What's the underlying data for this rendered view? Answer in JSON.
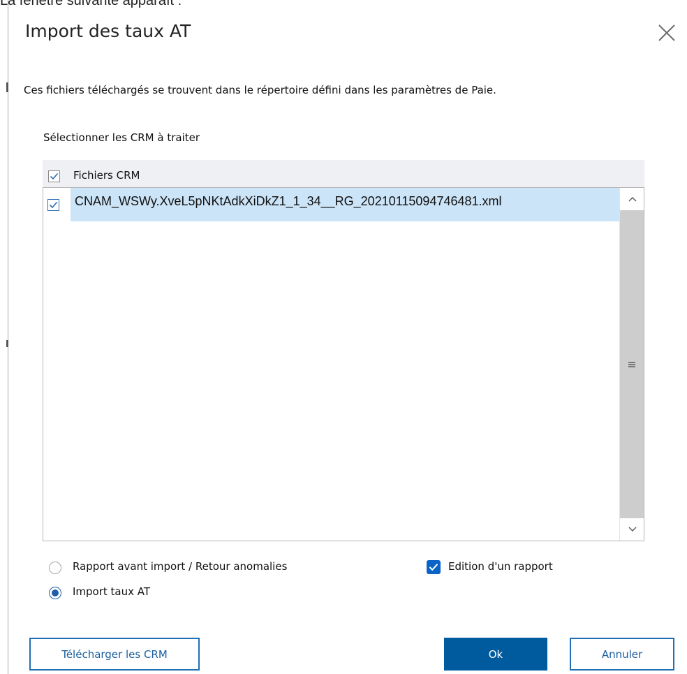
{
  "caption": "La fenêtre suivante apparaît :",
  "dialog": {
    "title": "Import des taux AT",
    "info_text": "Ces fichiers téléchargés se trouvent dans le répertoire défini dans les paramètres de Paie.",
    "section_label": "Sélectionner les CRM à traiter",
    "grid": {
      "header_label": "Fichiers CRM",
      "header_checked": true,
      "rows": [
        {
          "filename": "CNAM_WSWy.XveL5pNKtAdkXiDkZ1_1_34__RG_20210115094746481.xml",
          "checked": true,
          "selected": true
        }
      ]
    },
    "options": {
      "radio_rapport": {
        "label": "Rapport avant import / Retour anomalies",
        "selected": false
      },
      "radio_import": {
        "label": "Import taux AT",
        "selected": true
      },
      "checkbox_edition": {
        "label": "Edition d'un rapport",
        "checked": true
      }
    },
    "buttons": {
      "download": "Télécharger les CRM",
      "ok": "Ok",
      "cancel": "Annuler"
    }
  },
  "colors": {
    "primary": "#005a9e",
    "selection": "#cce4f7",
    "header_bg": "#eef0f3",
    "scroll_thumb": "#cdcdcd"
  }
}
